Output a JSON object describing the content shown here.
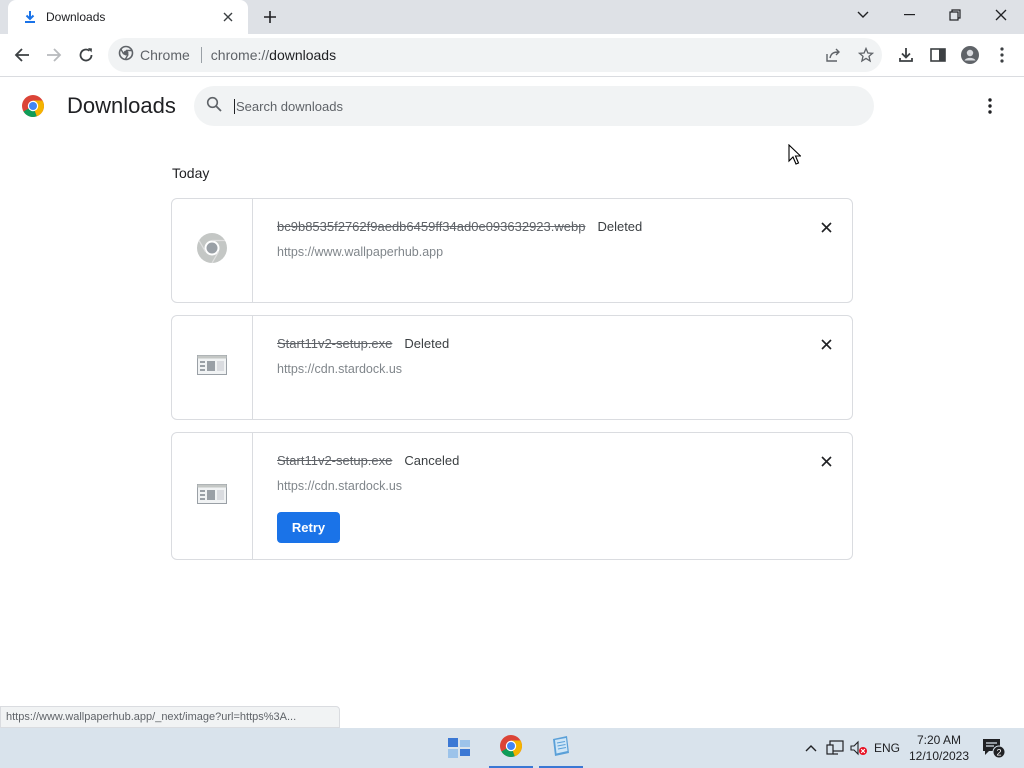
{
  "tab": {
    "title": "Downloads"
  },
  "omnibox": {
    "site": "Chrome",
    "url_scheme": "chrome://",
    "url_host": "downloads"
  },
  "header": {
    "title": "Downloads",
    "search_placeholder": "Search downloads"
  },
  "section": {
    "date": "Today"
  },
  "downloads": [
    {
      "name": "bc9b8535f2762f9aedb6459ff34ad0e093632923.webp",
      "status": "Deleted",
      "url": "https://www.wallpaperhub.app",
      "icon": "chrome-file-icon"
    },
    {
      "name": "Start11v2-setup.exe",
      "status": "Deleted",
      "url": "https://cdn.stardock.us",
      "icon": "exe-file-icon"
    },
    {
      "name": "Start11v2-setup.exe",
      "status": "Canceled",
      "url": "https://cdn.stardock.us",
      "icon": "exe-file-icon",
      "action": "Retry"
    }
  ],
  "status_bubble": "https://www.wallpaperhub.app/_next/image?url=https%3A...",
  "taskbar": {
    "language": "ENG",
    "time": "7:20 AM",
    "date": "12/10/2023",
    "notifications": "2"
  },
  "colors": {
    "accent": "#1a73e8",
    "taskbar": "#d9e3ec",
    "tabstrip": "#dee1e6"
  }
}
